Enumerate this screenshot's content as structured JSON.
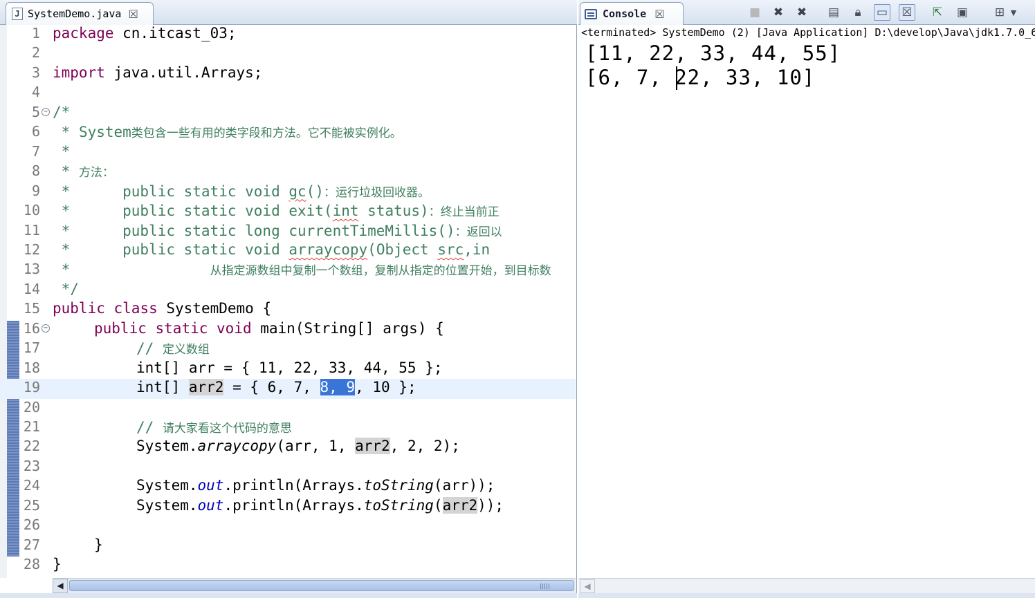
{
  "editor": {
    "tab": {
      "icon_letter": "J",
      "title": "SystemDemo.java",
      "close": "☒"
    },
    "line_numbers": [
      "1",
      "2",
      "3",
      "4",
      "5",
      "6",
      "7",
      "8",
      "9",
      "10",
      "11",
      "12",
      "13",
      "14",
      "15",
      "16",
      "17",
      "18",
      "19",
      "20",
      "21",
      "22",
      "23",
      "24",
      "25",
      "26",
      "27",
      "28"
    ],
    "code": {
      "l1_kw": "package",
      "l1_rest": " cn.itcast_03;",
      "l3_kw": "import",
      "l3_rest": " java.util.Arrays;",
      "l5": "/*",
      "l6_star": " * ",
      "l6_a": "System",
      "l6_cn": "类包含一些有用的类字段和方法。它不能被实例化。",
      "l7": " *",
      "l8_star": " * ",
      "l8_cn": "方法：",
      "l9_a": " *      public static void ",
      "l9_m": "gc",
      "l9_b": "()",
      "l9_cn": "：运行垃圾回收器。",
      "l10_a": " *      public static void exit(",
      "l10_m": "int",
      "l10_b": " status)",
      "l10_cn": "：终止当前正",
      "l11_a": " *      public static long currentTimeMillis()",
      "l11_cn": "：返回以",
      "l12_a": " *      public static void ",
      "l12_m": "arraycopy",
      "l12_b": "(Object ",
      "l12_m2": "src",
      "l12_c": ",in",
      "l13_star": " *                ",
      "l13_cn": "从指定源数组中复制一个数组，复制从指定的位置开始，到目标数",
      "l14": " */",
      "l15_kw1": "public",
      "l15_kw2": "class",
      "l15_rest": " SystemDemo {",
      "l16_kw1": "public",
      "l16_kw2": "static",
      "l16_kw3": "void",
      "l16_rest": " main(String[] args) {",
      "l17_c": "// ",
      "l17_cn": "定义数组",
      "l18": "int[] arr = { 11, 22, 33, 44, 55 };",
      "l19_a": "int[] ",
      "l19_var": "arr2",
      "l19_b": " = { 6, 7, ",
      "l19_sel": "8, 9",
      "l19_c": ", 10 };",
      "l21_c": "// ",
      "l21_cn": "请大家看这个代码的意思",
      "l22_a": "System.",
      "l22_m": "arraycopy",
      "l22_b": "(arr, 1, ",
      "l22_var": "arr2",
      "l22_c": ", 2, 2);",
      "l24_a": "System.",
      "l24_f": "out",
      "l24_b": ".println(Arrays.",
      "l24_m": "toString",
      "l24_c": "(arr));",
      "l25_a": "System.",
      "l25_f": "out",
      "l25_b": ".println(Arrays.",
      "l25_m": "toString",
      "l25_c": "(",
      "l25_var": "arr2",
      "l25_d": "));",
      "l27": "}",
      "l28": "}"
    },
    "scroll_left": "◀"
  },
  "console": {
    "tab": {
      "title": "Console",
      "close": "☒"
    },
    "toolbar": [
      "stop-icon",
      "remove-launch-icon",
      "remove-all-icon",
      "clear-console-icon",
      "scroll-lock-icon",
      "word-wrap-icon",
      "show-on-output-icon",
      "pin-console-icon",
      "display-selected-icon",
      "open-console-icon"
    ],
    "status": "<terminated> SystemDemo (2) [Java Application] D:\\develop\\Java\\jdk1.7.0_6",
    "output": [
      "[11, 22, 33, 44, 55]",
      "[6, 7, 22, 33, 10]"
    ],
    "scroll_left": "◀"
  }
}
